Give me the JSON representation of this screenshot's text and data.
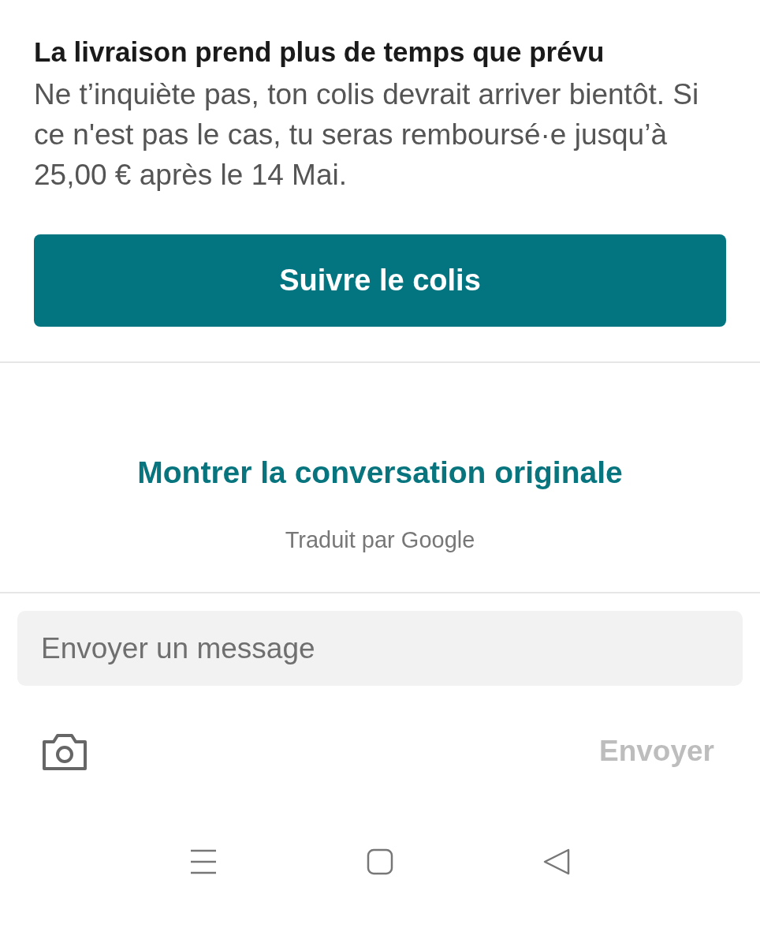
{
  "notice": {
    "title": "La livraison prend plus de temps que prévu",
    "message": "Ne t’inquiète pas, ton colis devrait arriver bientôt. Si ce n'est pas le cas, tu seras remboursé·e jusqu’à 25,00 € après le 14 Mai.",
    "button": "Suivre le colis"
  },
  "translation": {
    "link": "Montrer la conversation originale",
    "note": "Traduit par Google"
  },
  "composer": {
    "placeholder": "Envoyer un message",
    "send": {
      "label": "Envoyer",
      "disabled": true
    }
  }
}
